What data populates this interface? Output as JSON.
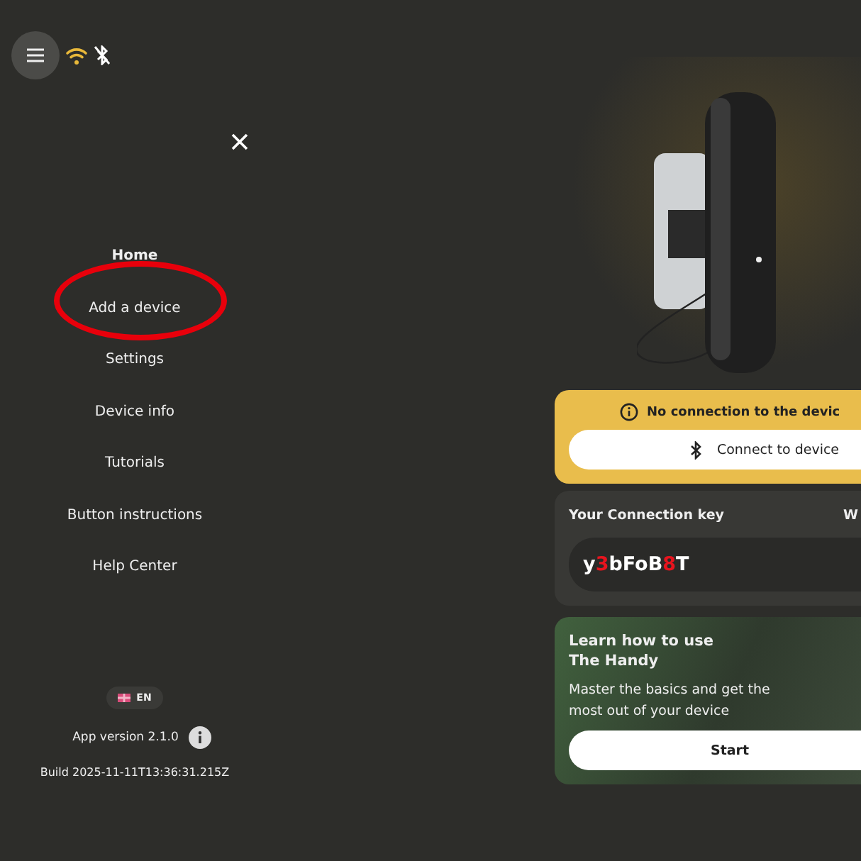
{
  "top_bar": {
    "wifi_on": true,
    "bluetooth_on": false
  },
  "menu": {
    "items": [
      {
        "label": "Home",
        "selected": true
      },
      {
        "label": "Add a device",
        "selected": false
      },
      {
        "label": "Settings",
        "selected": false
      },
      {
        "label": "Device info",
        "selected": false
      },
      {
        "label": "Tutorials",
        "selected": false
      },
      {
        "label": "Button instructions",
        "selected": false
      },
      {
        "label": "Help Center",
        "selected": false
      }
    ],
    "language": "EN",
    "app_version": "App version 2.1.0",
    "build": "Build 2025-11-11T13:36:31.215Z"
  },
  "annotation": {
    "kind": "ellipse",
    "color": "#e8000b"
  },
  "connection_card": {
    "status": "No connection to the devic",
    "button": "Connect to device"
  },
  "key_card": {
    "title": "Your Connection key",
    "column_2": "W",
    "key_parts": [
      {
        "text": "y",
        "highlight": false
      },
      {
        "text": "3",
        "highlight": true
      },
      {
        "text": "bFoB",
        "highlight": false
      },
      {
        "text": "8",
        "highlight": true
      },
      {
        "text": "T",
        "highlight": false
      }
    ]
  },
  "learn_card": {
    "title": "Learn how to use The Handy",
    "text": "Master the basics and get the most out of your device",
    "button": "Start"
  }
}
